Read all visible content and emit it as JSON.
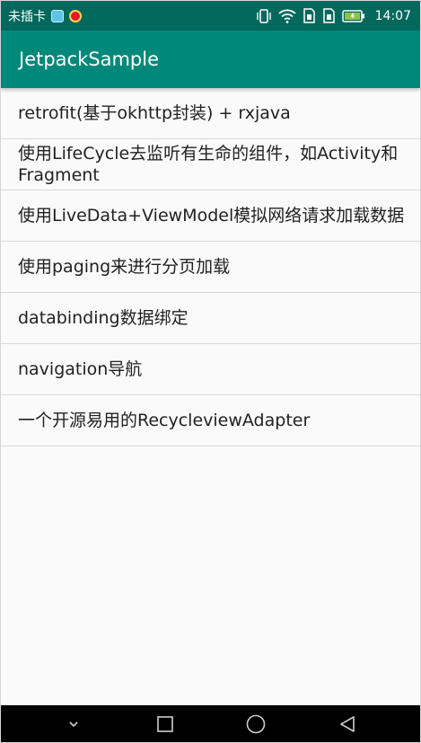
{
  "status_bar": {
    "carrier": "未插卡",
    "time": "14:07",
    "icons": [
      "app-notification-icon",
      "weibo-notification-icon",
      "vibrate-icon",
      "wifi-icon",
      "sim1-icon",
      "sim2-icon",
      "battery-icon"
    ]
  },
  "app_bar": {
    "title": "JetpackSample",
    "color": "#00897b",
    "status_color": "#00695c"
  },
  "list": {
    "items": [
      {
        "label": "retrofit(基于okhttp封装) + rxjava"
      },
      {
        "label": "使用LifeCycle去监听有生命的组件，如Activity和Fragment"
      },
      {
        "label": "使用LiveData+ViewModel模拟网络请求加载数据"
      },
      {
        "label": "使用paging来进行分页加载"
      },
      {
        "label": "databinding数据绑定"
      },
      {
        "label": "navigation导航"
      },
      {
        "label": "一个开源易用的RecycleviewAdapter"
      }
    ]
  },
  "nav_bar": {
    "buttons": [
      "chevron-down-icon",
      "recents-icon",
      "home-icon",
      "back-icon"
    ]
  }
}
